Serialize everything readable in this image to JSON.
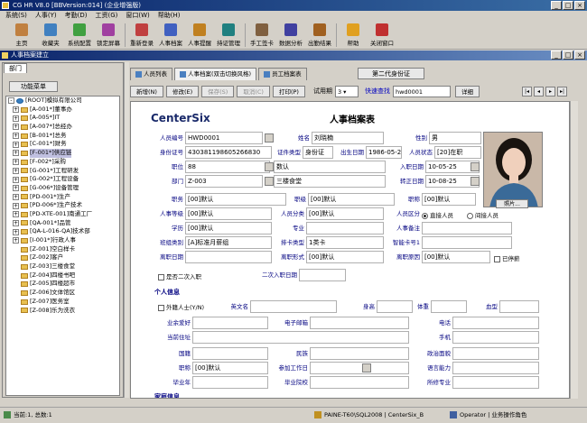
{
  "window": {
    "title": "CG HR V8.0 [BBVersion:014] (企业增强版)"
  },
  "menu": [
    "系统(S)",
    "人事(Y)",
    "考勤(D)",
    "工资(G)",
    "窗口(W)",
    "帮助(H)"
  ],
  "toolbar": [
    "主页",
    "收藏夹",
    "系统配置",
    "锁定屏幕",
    "重新登录",
    "人事档案",
    "人事提醒",
    "持证管理",
    "手工签卡",
    "数据分析",
    "出勤结果",
    "帮助",
    "关闭窗口"
  ],
  "child_title": "人事档案建立",
  "left": {
    "tab": "部门",
    "func_btn": "功能菜单",
    "tree": [
      {
        "t": "[ROOT]模拟有限公司",
        "lv": 0,
        "pm": "-"
      },
      {
        "t": "[A-001*]董事办",
        "lv": 1,
        "pm": "+"
      },
      {
        "t": "[A-005*]IT",
        "lv": 1,
        "pm": "+"
      },
      {
        "t": "[A-007*]总经办",
        "lv": 1,
        "pm": "+"
      },
      {
        "t": "[B-001*]总务",
        "lv": 1,
        "pm": "+"
      },
      {
        "t": "[C-001*]财务",
        "lv": 1,
        "pm": "+"
      },
      {
        "t": "[F-001*]供应链",
        "lv": 1,
        "pm": "+",
        "sel": true
      },
      {
        "t": "[F-002*]采购",
        "lv": 1,
        "pm": "+"
      },
      {
        "t": "[G-001*]工程研发",
        "lv": 1,
        "pm": "+"
      },
      {
        "t": "[G-002*]工程设备",
        "lv": 1,
        "pm": "+"
      },
      {
        "t": "[G-006*]设备管理",
        "lv": 1,
        "pm": "+"
      },
      {
        "t": "[PD-001*]生产",
        "lv": 1,
        "pm": "+"
      },
      {
        "t": "[PD-006*]生产技术",
        "lv": 1,
        "pm": "+"
      },
      {
        "t": "[PD-XTE-001]南通工厂",
        "lv": 1,
        "pm": "+"
      },
      {
        "t": "[QA-001*]品管",
        "lv": 1,
        "pm": "+"
      },
      {
        "t": "[QA-L-016-QA]技术部",
        "lv": 1,
        "pm": "+"
      },
      {
        "t": "[I-001*]行政人事",
        "lv": 1,
        "pm": "+"
      },
      {
        "t": "[Z-001]空白样卡",
        "lv": 1,
        "pm": ""
      },
      {
        "t": "[Z-002]客户",
        "lv": 1,
        "pm": ""
      },
      {
        "t": "[Z-003]三楼食堂",
        "lv": 1,
        "pm": ""
      },
      {
        "t": "[Z-004]四楼书吧",
        "lv": 1,
        "pm": ""
      },
      {
        "t": "[Z-005]四楼超市",
        "lv": 1,
        "pm": ""
      },
      {
        "t": "[Z-006]文体馆区",
        "lv": 1,
        "pm": ""
      },
      {
        "t": "[Z-007]医务室",
        "lv": 1,
        "pm": ""
      },
      {
        "t": "[Z-008]乐为洗衣",
        "lv": 1,
        "pm": ""
      }
    ]
  },
  "tabs": [
    "人员列表",
    "人事档案(双击切换风格)",
    "员工档案表"
  ],
  "second_btn": "第二代身份证",
  "actions": {
    "new": "新增(N)",
    "edit": "修改(E)",
    "save": "保存(S)",
    "cancel": "取消(C)",
    "print": "打印(P)",
    "trial_label": "试用期",
    "trial_val": "3",
    "quick_label": "快速查找",
    "quick_val": "hwd0001",
    "detail": "详细"
  },
  "form": {
    "logo": "CenterSix",
    "title": "人事档案表",
    "emp_no_l": "人员编号",
    "emp_no": "HWD0001",
    "name_l": "姓名",
    "name": "刘晓楠",
    "sex_l": "性别",
    "sex": "男",
    "id_l": "身份证号",
    "id": "430381198605266830",
    "cert_l": "证件类型",
    "cert": "身份证",
    "birth_l": "出生日期",
    "birth": "1986-05-26",
    "status_l": "人员状态",
    "status": "[20]在职",
    "pos_l": "职位",
    "pos": "88",
    "num_l": "数认",
    "hire_l": "入职日期",
    "hire": "10-05-25",
    "dept_l": "部门",
    "dept": "Z-003",
    "canteen": "三楼食堂",
    "reg_l": "转正日期",
    "reg": "10-08-25",
    "rank_l": "职务",
    "rank": "[00]默认",
    "grade_l": "职级",
    "grade": "[00]默认",
    "title_l": "职称",
    "title_v": "[00]默认",
    "level_l": "人事等级",
    "level": "[00]默认",
    "cat_l": "人员分类",
    "cat": "[00]默认",
    "zone_l": "人员区分",
    "direct": "直接人员",
    "indirect": "间接人员",
    "edu_l": "学历",
    "edu": "[00]默认",
    "major_l": "专业",
    "note_l": "人事备注",
    "shift_l": "班组类别",
    "shift": "[A]标准月薪组",
    "card_l": "排卡类型",
    "card": "1类卡",
    "smart_l": "智能卡号1",
    "leave_l": "离职日期",
    "leave_type_l": "离职形式",
    "leave_type": "[00]默认",
    "leave_reason_l": "离职原因",
    "leave_reason": "[00]默认",
    "stop": "已停薪",
    "second_chk": "是否二次入职",
    "second_date_l": "二次入职日期",
    "sec2": "个人信息",
    "foreign_l": "外籍人士(Y/N)",
    "en_l": "英文名",
    "height_l": "身高",
    "weight_l": "体重",
    "blood_l": "血型",
    "hobby_l": "业余爱好",
    "email_l": "电子邮箱",
    "tel_l": "电话",
    "addr_l": "当前住址",
    "mobile_l": "手机",
    "nation_l": "国籍",
    "ethnic_l": "民族",
    "party_l": "政治面貌",
    "jobpos_l": "职称",
    "jobpos": "[00]默认",
    "work_l": "参加工作日",
    "lang_l": "语言能力",
    "grad_l": "毕业年",
    "school_l": "毕业院校",
    "spec_l": "所修专业",
    "family_l": "家庭信息",
    "photo_btn": "照片..."
  },
  "status": {
    "left": "当前:1, 总数:1",
    "db": "PAINE-T60\\SQL2008 | CenterSix_B",
    "op": "Operator | 业务操作角色"
  }
}
